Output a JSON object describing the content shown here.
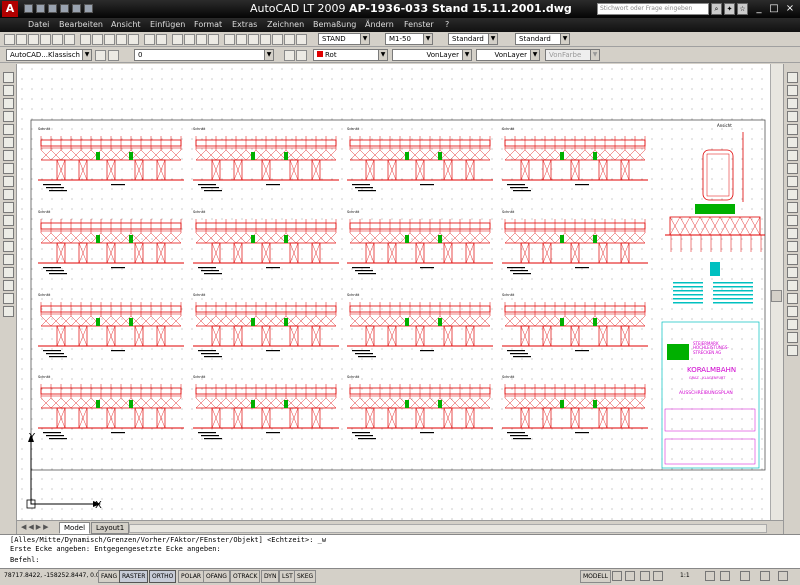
{
  "window": {
    "app_name": "AutoCAD LT 2009",
    "document_title": "AP-1936-033 Stand 15.11.2001.dwg",
    "search_placeholder": "Stichwort oder Frage eingeben"
  },
  "menu": [
    "Datei",
    "Bearbeiten",
    "Ansicht",
    "Einfügen",
    "Format",
    "Extras",
    "Zeichnen",
    "Bemaßung",
    "Ändern",
    "Fenster",
    "?"
  ],
  "toolbar": {
    "textstyle": "STAND",
    "dimstyle": "M1-50",
    "tablestyle": "Standard",
    "mleaderstyle": "Standard",
    "workspace": "AutoCAD...Klassisch",
    "layer": "0",
    "color": "Rot",
    "linetype": "VonLayer",
    "lineweight": "VonLayer",
    "plotstyle": "VonFarbe"
  },
  "drawing": {
    "section_label": "Schnitt",
    "side_view_label": "Ansicht",
    "title_block": {
      "client_line1": "STEIERMARK",
      "client_line2": "HOCHLEISTUNGS-",
      "client_line3": "STRECKEN AG",
      "project": "KORALMBAHN",
      "sub": "GRAZ - KLAGENFURT",
      "plan": "AUSSCHREIBUNGSPLAN"
    },
    "ucs_x": "X",
    "ucs_y": "Y"
  },
  "tabs": [
    "Model",
    "Layout1"
  ],
  "command": {
    "line1": "[Alles/Mitte/Dynamisch/Grenzen/Vorher/FAktor/FEnster/Objekt] <Echtzeit>: _w",
    "line2": "Erste Ecke angeben: Entgegengesetzte Ecke angeben:",
    "prompt": "Befehl:"
  },
  "status": {
    "coords": "78717.8422, -158252.8447, 0.0000",
    "toggles": [
      "FANG",
      "RASTER",
      "ORTHO",
      "POLAR",
      "OFANG",
      "OTRACK",
      "DYN",
      "LST",
      "SKEG"
    ],
    "toggles_on": [
      "RASTER",
      "ORTHO"
    ],
    "model": "MODELL",
    "scale": "1:1"
  },
  "colors": {
    "drawing_red": "#e00000",
    "drawing_green": "#00b000",
    "title_magenta": "#d000d0",
    "title_cyan": "#00c0c0"
  }
}
